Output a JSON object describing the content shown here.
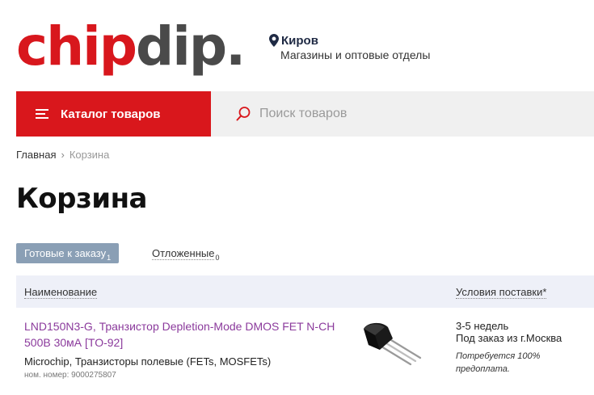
{
  "logo": {
    "part1": "chip",
    "part2": "dip."
  },
  "location": {
    "city": "Киров",
    "stores": "Магазины и оптовые отделы"
  },
  "catalog_button": {
    "label": "Каталог товаров"
  },
  "search": {
    "placeholder": "Поиск товаров",
    "value": ""
  },
  "breadcrumb": {
    "home": "Главная",
    "separator": "›",
    "current": "Корзина"
  },
  "page_title": "Корзина",
  "tabs": [
    {
      "label": "Готовые к заказу",
      "count": "1"
    },
    {
      "label": "Отложенные",
      "count": "0"
    }
  ],
  "table": {
    "headers": {
      "name": "Наименование",
      "delivery": "Условия поставки*"
    },
    "items": [
      {
        "title": "LND150N3-G, Транзистор Depletion-Mode DMOS FET N-CH 500В 30мА [TO-92]",
        "maker": "Microchip, Транзисторы полевые (FETs, MOSFETs)",
        "number": "ном. номер: 9000275807",
        "image_icon": "to92-transistor-icon",
        "delivery_time": "3-5 недель",
        "delivery_source": "Под заказ из г.Москва",
        "delivery_note": "Потребуется 100% предоплата."
      }
    ]
  },
  "colors": {
    "brand_red": "#d9171c",
    "logo_gray": "#4a4a4a",
    "tab_active": "#8a9fb5",
    "product_link": "#8b3a9c",
    "header_bg": "#eef0f8"
  }
}
